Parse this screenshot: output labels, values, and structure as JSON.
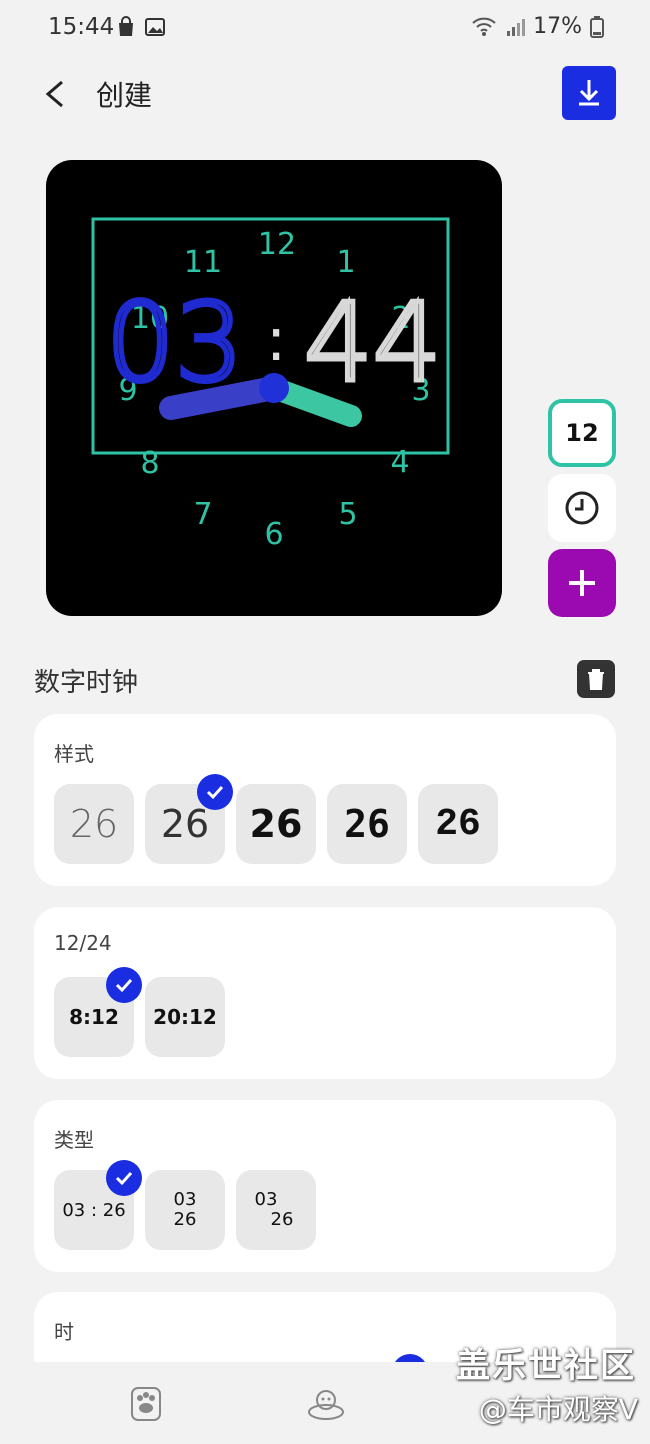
{
  "status": {
    "time": "15:44",
    "battery": "17%"
  },
  "header": {
    "title": "创建"
  },
  "preview": {
    "digits_hour": "03",
    "separator": ":",
    "digits_min": "44",
    "dial_numbers": [
      "12",
      "1",
      "2",
      "3",
      "4",
      "5",
      "6",
      "7",
      "8",
      "9",
      "10",
      "11"
    ]
  },
  "side": {
    "format_label": "12"
  },
  "section": {
    "title": "数字时钟"
  },
  "cards": {
    "style": {
      "label": "样式",
      "options": [
        "26",
        "26",
        "26",
        "26",
        "26"
      ]
    },
    "format": {
      "label": "12/24",
      "options": [
        "8:12",
        "20:12"
      ]
    },
    "type": {
      "label": "类型",
      "options": [
        {
          "top": "03 : 26"
        },
        {
          "top": "03",
          "bottom": "26"
        },
        {
          "top": "03",
          "bottom": "26"
        }
      ]
    },
    "hour": {
      "label": "时"
    }
  },
  "watermark": {
    "line1": "盖乐世社区",
    "line2": "@车市观察V"
  },
  "colors": {
    "accent_blue": "#1a2de0",
    "teal": "#2fc3a6",
    "purple": "#9a0ab0"
  }
}
